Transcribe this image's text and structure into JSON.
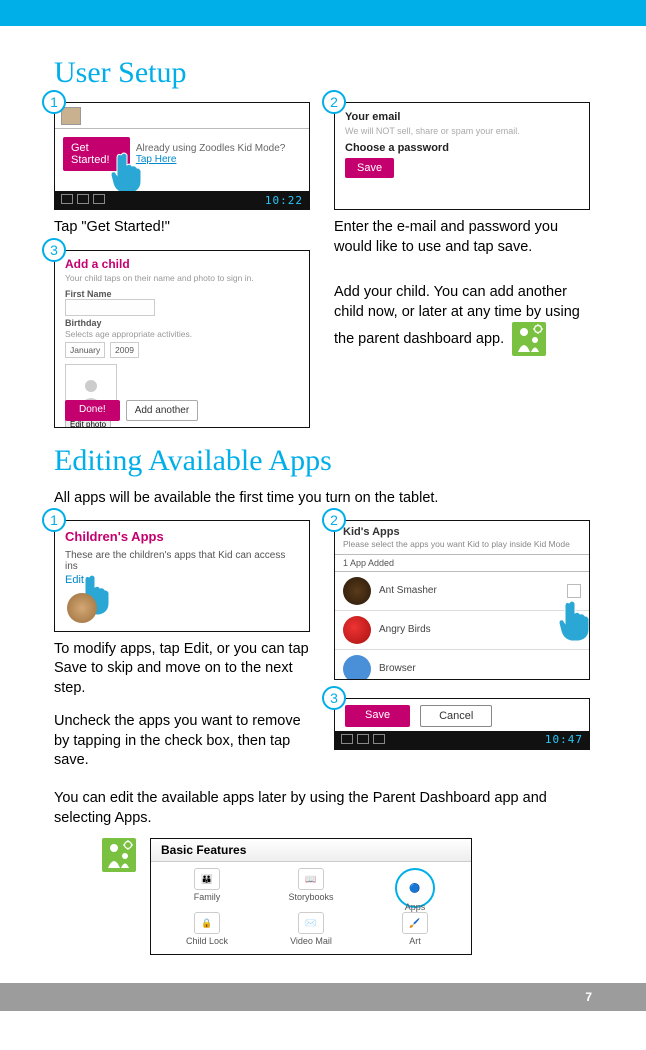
{
  "page_number": "7",
  "section1": {
    "title": "User Setup",
    "step1": {
      "badge": "1",
      "button": "Get Started!",
      "note_prefix": "Already using Zoodles Kid Mode?",
      "note_link": "Tap Here",
      "clock": "10:22",
      "caption": "Tap \"Get Started!\""
    },
    "step2": {
      "badge": "2",
      "label_email": "Your email",
      "disclaimer": "We will NOT sell, share or spam your email.",
      "label_pw": "Choose a password",
      "save": "Save",
      "caption": "Enter the e-mail and pass­word you would like to use and tap save."
    },
    "step3": {
      "badge": "3",
      "title": "Add a child",
      "sub": "Your child taps on their name and photo to sign in.",
      "first_name": "First Name",
      "birthday": "Birthday",
      "bday_sub": "Selects age appropriate activities.",
      "month": "January",
      "year": "2009",
      "edit_photo": "Edit photo",
      "done": "Done!",
      "add_another": "Add another",
      "paragraph": "Add your child. You can add another child now, or later at any time by using the parent dashboard app."
    }
  },
  "section2": {
    "title": "Editing Available Apps",
    "intro": "All apps will be available the first time you turn on the tablet.",
    "step1": {
      "badge": "1",
      "title": "Children's Apps",
      "desc": "These are the children's apps that Kid can access ins",
      "edit": "Edit",
      "caption": "To modify apps, tap Edit, or you can tap Save to skip and move on to the next step.",
      "caption2": "Uncheck the apps you want to remove by tapping in the check box, then tap save."
    },
    "step2": {
      "badge": "2",
      "title": "Kid's Apps",
      "desc": "Please select the apps you want Kid to play inside Kid Mode",
      "count": "1 App Added",
      "app1": "Ant Smasher",
      "app2": "Angry Birds",
      "app3": "Browser"
    },
    "step3": {
      "badge": "3",
      "save": "Save",
      "cancel": "Cancel",
      "clock": "10:47"
    },
    "outro": "You can edit the available apps later by using the Parent Dash­board app and selecting Apps.",
    "bf": {
      "title": "Basic Features",
      "i1": "Family",
      "i2": "Storybooks",
      "i3": "Apps",
      "i4": "Child Lock",
      "i5": "Video Mail",
      "i6": "Art"
    }
  }
}
